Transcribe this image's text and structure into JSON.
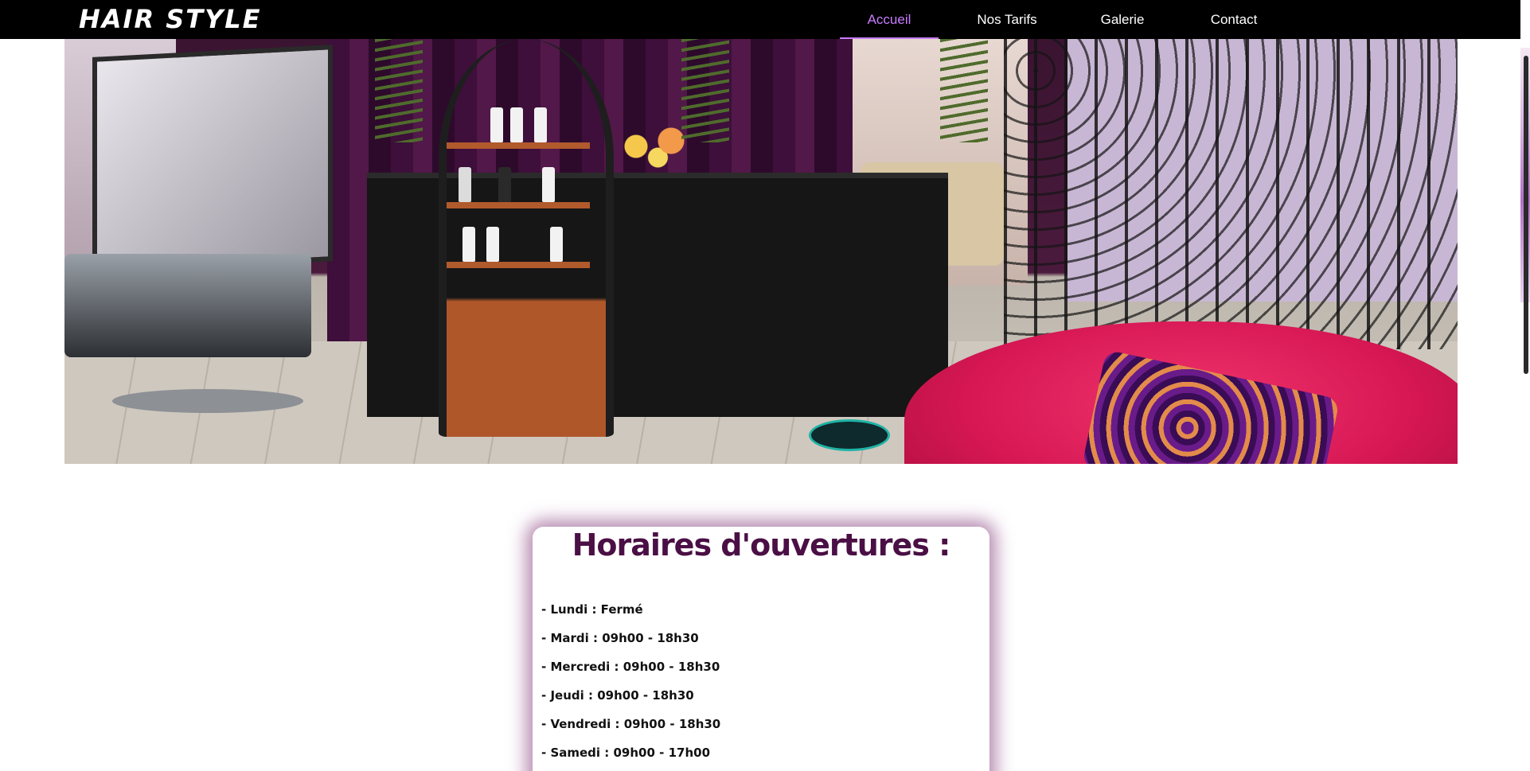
{
  "site": {
    "brand": "HAIR STYLE"
  },
  "nav": {
    "items": [
      {
        "label": "Accueil",
        "active": true
      },
      {
        "label": "Nos Tarifs",
        "active": false
      },
      {
        "label": "Galerie",
        "active": false
      },
      {
        "label": "Contact",
        "active": false
      }
    ]
  },
  "hero": {
    "icon": "salon-interior-photo"
  },
  "hours": {
    "title": "Horaires d'ouvertures :",
    "items": [
      "- Lundi : Fermé",
      "- Mardi : 09h00 - 18h30",
      "- Mercredi : 09h00 - 18h30",
      "- Jeudi : 09h00 - 18h30",
      "- Vendredi : 09h00 - 18h30",
      "- Samedi : 09h00 - 17h00"
    ]
  },
  "colors": {
    "navbar_bg": "#000000",
    "nav_active": "#c77dff",
    "title_color": "#4a0f45",
    "card_glow": "#782870"
  }
}
